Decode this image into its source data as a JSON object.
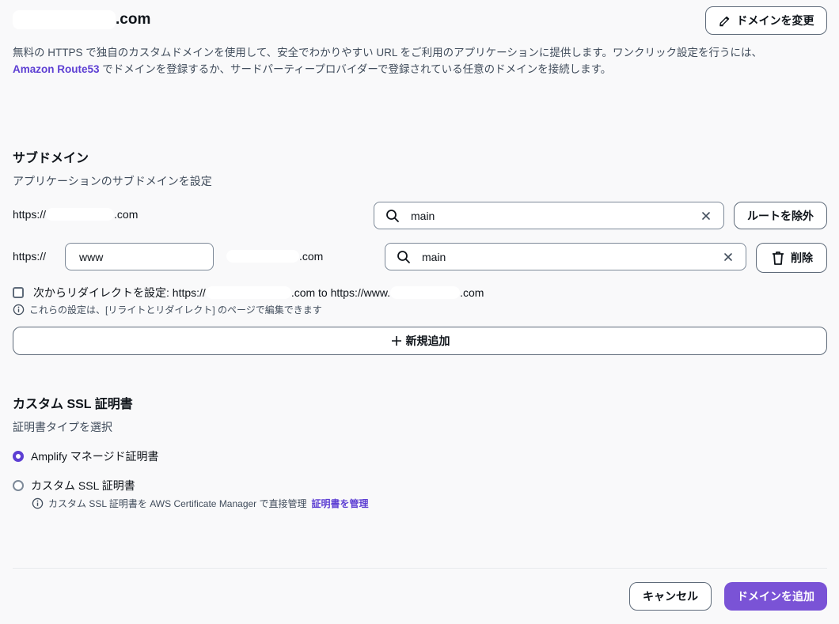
{
  "header": {
    "domain_suffix": ".com",
    "change_domain_label": "ドメインを変更"
  },
  "description": {
    "line1": "無料の HTTPS で独自のカスタムドメインを使用して、安全でわかりやすい URL をご利用のアプリケーションに提供します。ワンクリック設定を行うには、",
    "link": "Amazon Route53",
    "line2": " でドメインを登録するか、サードパーティープロバイダーで登録されている任意のドメインを接続します。"
  },
  "subdomain": {
    "title": "サブドメイン",
    "subtitle": "アプリケーションのサブドメインを設定",
    "root_row": {
      "prefix": "https://",
      "suffix": ".com",
      "branch_value": "main",
      "remove_root_label": "ルートを除外"
    },
    "www_row": {
      "prefix": "https://",
      "subdomain_value": "www",
      "suffix": ".com",
      "branch_value": "main",
      "delete_label": "削除"
    },
    "redirect": {
      "label_start": "次からリダイレクトを設定: https://",
      "label_mid": ".com to https://www.",
      "label_end": ".com"
    },
    "info_text": "これらの設定は、[リライトとリダイレクト] のページで編集できます",
    "add_new_label": "新規追加"
  },
  "ssl": {
    "title": "カスタム SSL 証明書",
    "subtitle": "証明書タイプを選択",
    "options": [
      {
        "label": "Amplify マネージド証明書",
        "checked": true
      },
      {
        "label": "カスタム SSL 証明書",
        "checked": false
      }
    ],
    "info_text": "カスタム SSL 証明書を AWS Certificate Manager で直接管理",
    "info_link": "証明書を管理"
  },
  "footer": {
    "cancel_label": "キャンセル",
    "submit_label": "ドメインを追加"
  },
  "colors": {
    "accent": "#5d3fd3",
    "primary_button": "#7a53d6"
  }
}
